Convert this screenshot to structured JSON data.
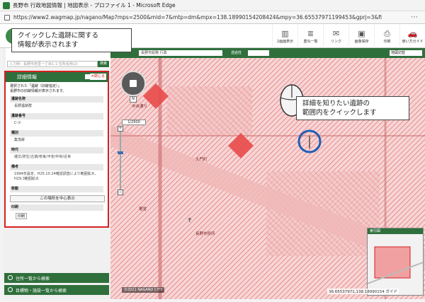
{
  "window": {
    "title": "長野市 行政地図情報 | 地図表示 - プロファイル 1 - Microsoft Edge"
  },
  "browser": {
    "url": "https://www2.wagmap.jp/nagano/Map?mps=2500&mid=7&mtp=dm&mpx=138.18990154208424&mpy=36.65537971199453&gprj=3&fid=..."
  },
  "toolbar": {
    "items": [
      {
        "label": "2画面表示",
        "icon": "split-screen-icon"
      },
      {
        "label": "重ね一覧",
        "icon": "layers-icon"
      },
      {
        "label": "リンク",
        "icon": "link-icon"
      },
      {
        "label": "画像保存",
        "icon": "save-image-icon"
      },
      {
        "label": "印刷",
        "icon": "print-icon"
      },
      {
        "label": "使い方ガイド",
        "icon": "guide-icon"
      }
    ]
  },
  "search": {
    "placeholder": "入力例：長野市若里一丁目1-1 住所名称(2)",
    "button": "検索"
  },
  "info_panel": {
    "title": "詳細情報",
    "close_label": "✕閉じる",
    "selected_line": "選択された「遺跡（旧跡指定）」",
    "description": "長野市の旧跡情報が表示されます。",
    "fields": [
      {
        "label": "遺跡名称",
        "value": "長野遺跡群"
      },
      {
        "label": "遺跡番号",
        "value": "C-②"
      },
      {
        "label": "種別",
        "value": "集落跡"
      },
      {
        "label": "時代",
        "value": "縄文/弥生/古墳/奈良/平安/中世/近世"
      },
      {
        "label": "備考",
        "value": "1994年設定、H25.10.24確認調査により範囲拡大、H29.3範囲拡大"
      },
      {
        "label": "移動",
        "value": ""
      }
    ],
    "center_button": "この場所を中心表示",
    "print_label": "印刷",
    "print_button": "印刷"
  },
  "accordion": [
    {
      "label": "住所一覧から検索"
    },
    {
      "label": "目標物・施設一覧から検索"
    }
  ],
  "map_bar": {
    "selector": "長野市総務 行政",
    "transparency_label": "透過性",
    "layer_select": "地図切替"
  },
  "map": {
    "scale_label": "1/2500",
    "north_label": "N",
    "zoom_in": "+",
    "zoom_out": "−",
    "copyright": "©2021 NAGANO CITY",
    "coords": "36.65537971,138.18990154 ガイド",
    "overview_title": "索引図",
    "labels": [
      "中央通り",
      "大門町",
      "長野市役所",
      "権堂"
    ]
  },
  "callouts": {
    "top": "クイックした遺跡に関する\n情報が表示されます",
    "right": "詳細を知りたい遺跡の\n範囲内をクイックします"
  },
  "colors": {
    "accent": "#2f6f3c",
    "highlight": "#d62020",
    "hatch": "#e06060",
    "circle": "#1f5fb5"
  }
}
